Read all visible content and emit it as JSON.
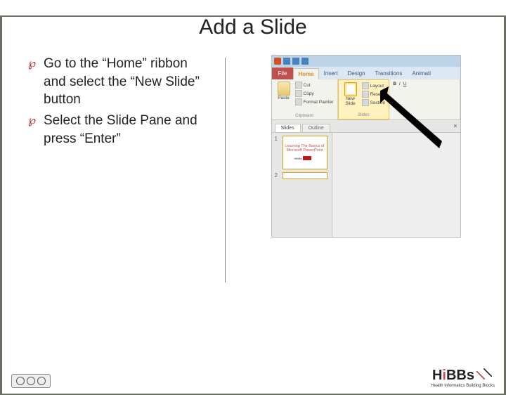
{
  "title": "Add a Slide",
  "bullets": [
    "Go to the “Home” ribbon and select the “New Slide” button",
    "Select the Slide Pane and press “Enter”"
  ],
  "ppt": {
    "tabs": {
      "file": "File",
      "home": "Home",
      "insert": "Insert",
      "design": "Design",
      "transitions": "Transitions",
      "anim": "Animati"
    },
    "clipboard": {
      "paste": "Paste",
      "cut": "Cut",
      "copy": "Copy",
      "fmt": "Format Painter",
      "group": "Clipboard"
    },
    "slides": {
      "new": "New\nSlide",
      "layout": "Layout",
      "reset": "Reset",
      "section": "Section",
      "group": "Slides"
    },
    "pane": {
      "slides_tab": "Slides",
      "outline_tab": "Outline"
    },
    "thumb1": {
      "num": "1",
      "line1": "Learning The Basics of",
      "line2": "Microsoft PowerPoint"
    },
    "thumb2": {
      "num": "2"
    }
  },
  "hibbs": {
    "brand": "H",
    "i": "i",
    "rest": "BBs",
    "tag": "Health Informatics Building Blocks"
  }
}
